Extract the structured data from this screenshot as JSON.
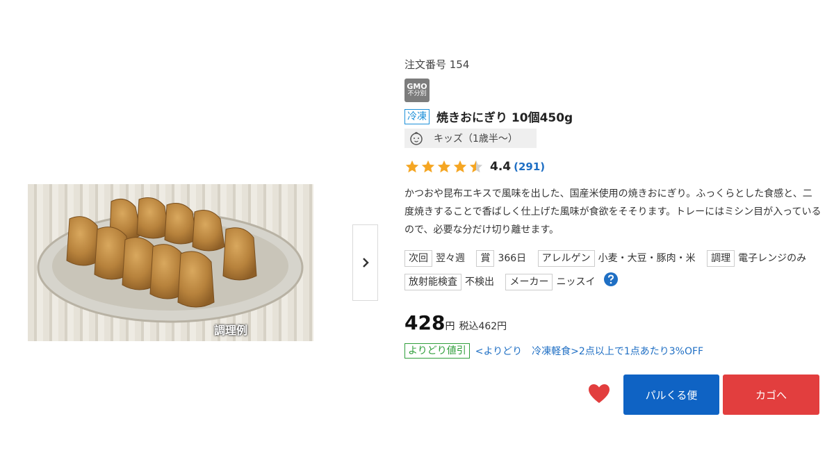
{
  "image": {
    "caption": "調理例"
  },
  "order": {
    "label": "注文番号 154"
  },
  "badge": {
    "line1": "GMO",
    "line2": "不分別"
  },
  "product": {
    "frozen_tag": "冷凍",
    "title": "焼きおにぎり 10個450g",
    "kids_label": "キッズ（1歳半〜）",
    "rating": "4.4",
    "review_count": "(291)",
    "description": "かつおや昆布エキスで風味を出した、国産米使用の焼きおにぎり。ふっくらとした食感と、二度焼きすることで香ばしく仕上げた風味が食欲をそそります。トレーにはミシン目が入っているので、必要な分だけ切り離せます。"
  },
  "specs": [
    {
      "label": "次回",
      "value": "翌々週"
    },
    {
      "label": "賞",
      "value": "366日"
    },
    {
      "label": "アレルゲン",
      "value": "小麦・大豆・豚肉・米"
    },
    {
      "label": "調理",
      "value": "電子レンジのみ"
    },
    {
      "label": "放射能検査",
      "value": "不検出"
    },
    {
      "label": "メーカー",
      "value": "ニッスイ"
    }
  ],
  "price": {
    "value": "428",
    "unit": "円",
    "tax_included": "税込462円"
  },
  "promo": {
    "tag": "よりどり値引",
    "text": "<よりどり　冷凍軽食>2点以上で1点あたり3%OFF"
  },
  "buttons": {
    "pal": "パルくる便",
    "cart": "カゴへ"
  },
  "colors": {
    "frozen": "#1b8fd8",
    "promo": "#2e9e3a",
    "link": "#1f6fc4",
    "pal_button": "#0f63c4",
    "cart_button": "#e23e3e",
    "heart": "#e23e3e",
    "star": "#f5a623"
  },
  "icons": {
    "kids": "baby-face-icon",
    "help": "question-circle-icon",
    "favorite": "heart-icon",
    "next": "chevron-right-icon",
    "rating": "star-icon"
  }
}
